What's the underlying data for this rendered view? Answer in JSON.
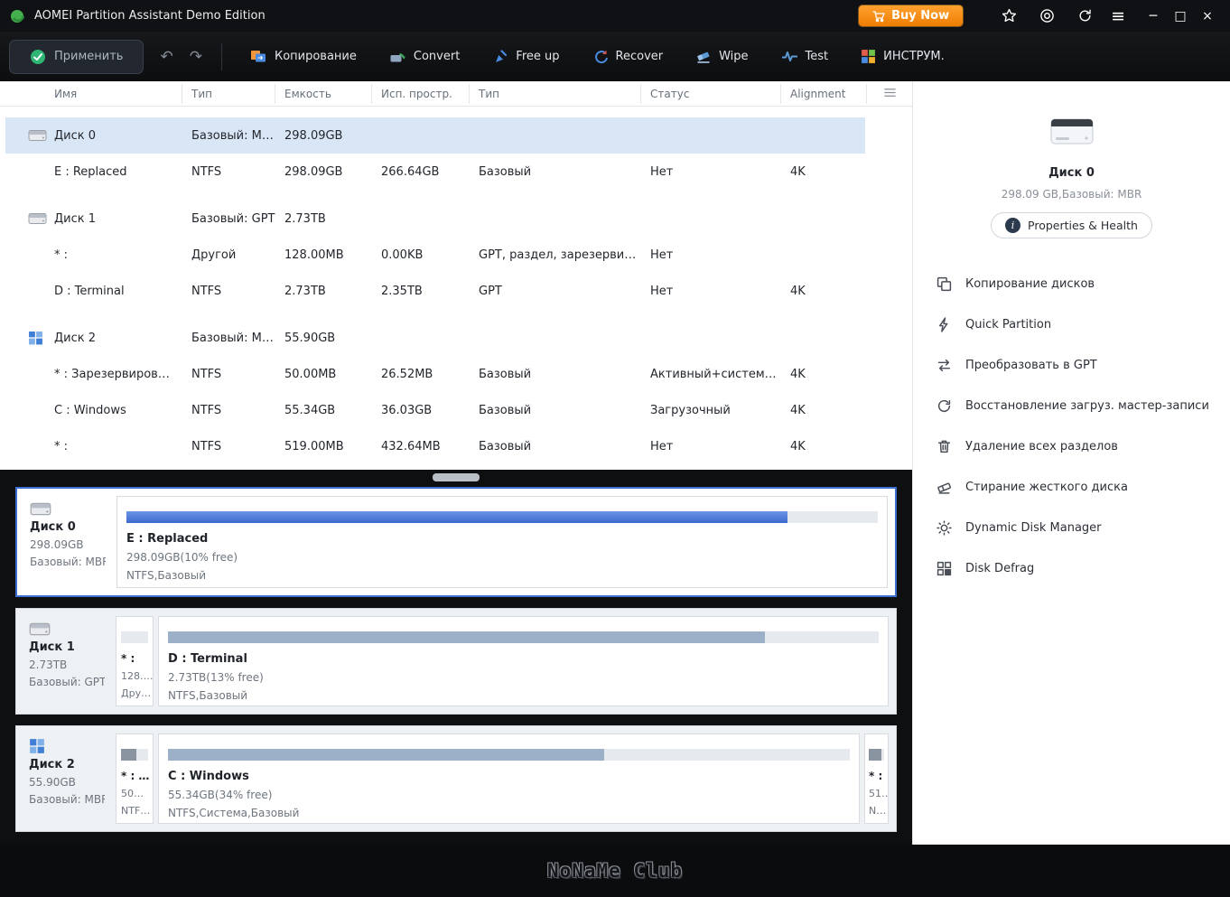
{
  "titlebar": {
    "title": "AOMEI Partition Assistant Demo Edition",
    "buy_now": "Buy Now"
  },
  "icons": {
    "minimize": "─",
    "maximize": "□",
    "close": "×",
    "menu": "≡",
    "undo": "↶",
    "redo": "↷",
    "info": "i"
  },
  "toolbar": {
    "apply": "Применить",
    "items": [
      {
        "label": "Копирование",
        "icon": "copy-icon"
      },
      {
        "label": "Convert",
        "icon": "convert-icon"
      },
      {
        "label": "Free up",
        "icon": "freeup-icon"
      },
      {
        "label": "Recover",
        "icon": "recover-icon"
      },
      {
        "label": "Wipe",
        "icon": "wipe-icon"
      },
      {
        "label": "Test",
        "icon": "test-icon"
      },
      {
        "label": "ИНСТРУМ.",
        "icon": "tools-grid-icon"
      }
    ]
  },
  "table": {
    "columns": [
      "Имя",
      "Тип",
      "Емкость",
      "Исп. простр.",
      "Тип",
      "Статус",
      "Alignment"
    ],
    "rows": [
      {
        "kind": "disk",
        "name": "Диск 0",
        "type": "Базовый: MBR",
        "capacity": "298.09GB",
        "used": "",
        "type2": "",
        "status": "",
        "alignment": ""
      },
      {
        "kind": "partition",
        "name": "E : Replaced",
        "type": "NTFS",
        "capacity": "298.09GB",
        "used": "266.64GB",
        "type2": "Базовый",
        "status": "Нет",
        "alignment": "4K"
      },
      {
        "kind": "disk",
        "name": "Диск 1",
        "type": "Базовый: GPT",
        "capacity": "2.73TB",
        "used": "",
        "type2": "",
        "status": "",
        "alignment": ""
      },
      {
        "kind": "partition",
        "name": "* :",
        "type": "Другой",
        "capacity": "128.00MB",
        "used": "0.00KB",
        "type2": "GPT, раздел, зарезервирова…",
        "status": "Нет",
        "alignment": ""
      },
      {
        "kind": "partition",
        "name": "D : Terminal",
        "type": "NTFS",
        "capacity": "2.73TB",
        "used": "2.35TB",
        "type2": "GPT",
        "status": "Нет",
        "alignment": "4K"
      },
      {
        "kind": "disk",
        "name": "Диск 2",
        "type": "Базовый: MBR",
        "capacity": "55.90GB",
        "used": "",
        "type2": "",
        "status": "",
        "alignment": ""
      },
      {
        "kind": "partition",
        "name": "* : Зарезервиров…",
        "type": "NTFS",
        "capacity": "50.00MB",
        "used": "26.52MB",
        "type2": "Базовый",
        "status": "Активный+системный",
        "alignment": "4K"
      },
      {
        "kind": "partition",
        "name": "C : Windows",
        "type": "NTFS",
        "capacity": "55.34GB",
        "used": "36.03GB",
        "type2": "Базовый",
        "status": "Загрузочный",
        "alignment": "4K"
      },
      {
        "kind": "partition",
        "name": "* :",
        "type": "NTFS",
        "capacity": "519.00MB",
        "used": "432.64MB",
        "type2": "Базовый",
        "status": "Нет",
        "alignment": "4K"
      }
    ]
  },
  "disk_cards": [
    {
      "name": "Диск 0",
      "size": "298.09GB",
      "table": "Базовый: MBR",
      "selected": true,
      "partitions": [
        {
          "name": "E : Replaced",
          "size": "298.09GB(10% free)",
          "fs": "NTFS,Базовый",
          "fill_style": "width:88%"
        }
      ]
    },
    {
      "name": "Диск 1",
      "size": "2.73TB",
      "table": "Базовый: GPT",
      "selected": false,
      "partitions": [
        {
          "name": "* :",
          "size": "128….",
          "fs": "Дру…",
          "fill_style": "width:0%"
        },
        {
          "name": "D : Terminal",
          "size": "2.73TB(13% free)",
          "fs": "NTFS,Базовый",
          "fill_style": "width:84%"
        }
      ]
    },
    {
      "name": "Диск 2",
      "size": "55.90GB",
      "table": "Базовый: MBR",
      "selected": false,
      "partitions": [
        {
          "name": "* : …",
          "size": "50…",
          "fs": "NTF…",
          "fill_style": "width:55%"
        },
        {
          "name": "C : Windows",
          "size": "55.34GB(34% free)",
          "fs": "NTFS,Система,Базовый",
          "fill_style": "width:64%"
        },
        {
          "name": "* :",
          "size": "51…",
          "fs": "N…",
          "fill_style": "width:85%"
        }
      ]
    }
  ],
  "sidebar": {
    "disk_name": "Диск 0",
    "disk_info": "298.09 GB,Базовый: MBR",
    "properties": "Properties & Health",
    "menu": [
      {
        "label": "Копирование дисков",
        "icon": "copy-disks-icon"
      },
      {
        "label": "Quick Partition",
        "icon": "lightning-icon"
      },
      {
        "label": "Преобразовать в GPT",
        "icon": "convert-arrows-icon"
      },
      {
        "label": "Восстановление загруз. мастер-записи",
        "icon": "restore-icon"
      },
      {
        "label": "Удаление всех разделов",
        "icon": "trash-icon"
      },
      {
        "label": "Стирание жесткого диска",
        "icon": "eraser-icon"
      },
      {
        "label": "Dynamic Disk Manager",
        "icon": "gear-icon"
      },
      {
        "label": "Disk Defrag",
        "icon": "defrag-grid-icon"
      }
    ]
  },
  "watermark": "NoNaMe Club",
  "colors": {
    "accent_blue": "#3a6ed0",
    "bar_blue": "#4a7bd8",
    "bar_gray": "#9cb0c8",
    "buy_now_orange": "#ef7d02",
    "selected_row": "#d9e6f6",
    "titlebar_bg": "#101114"
  }
}
